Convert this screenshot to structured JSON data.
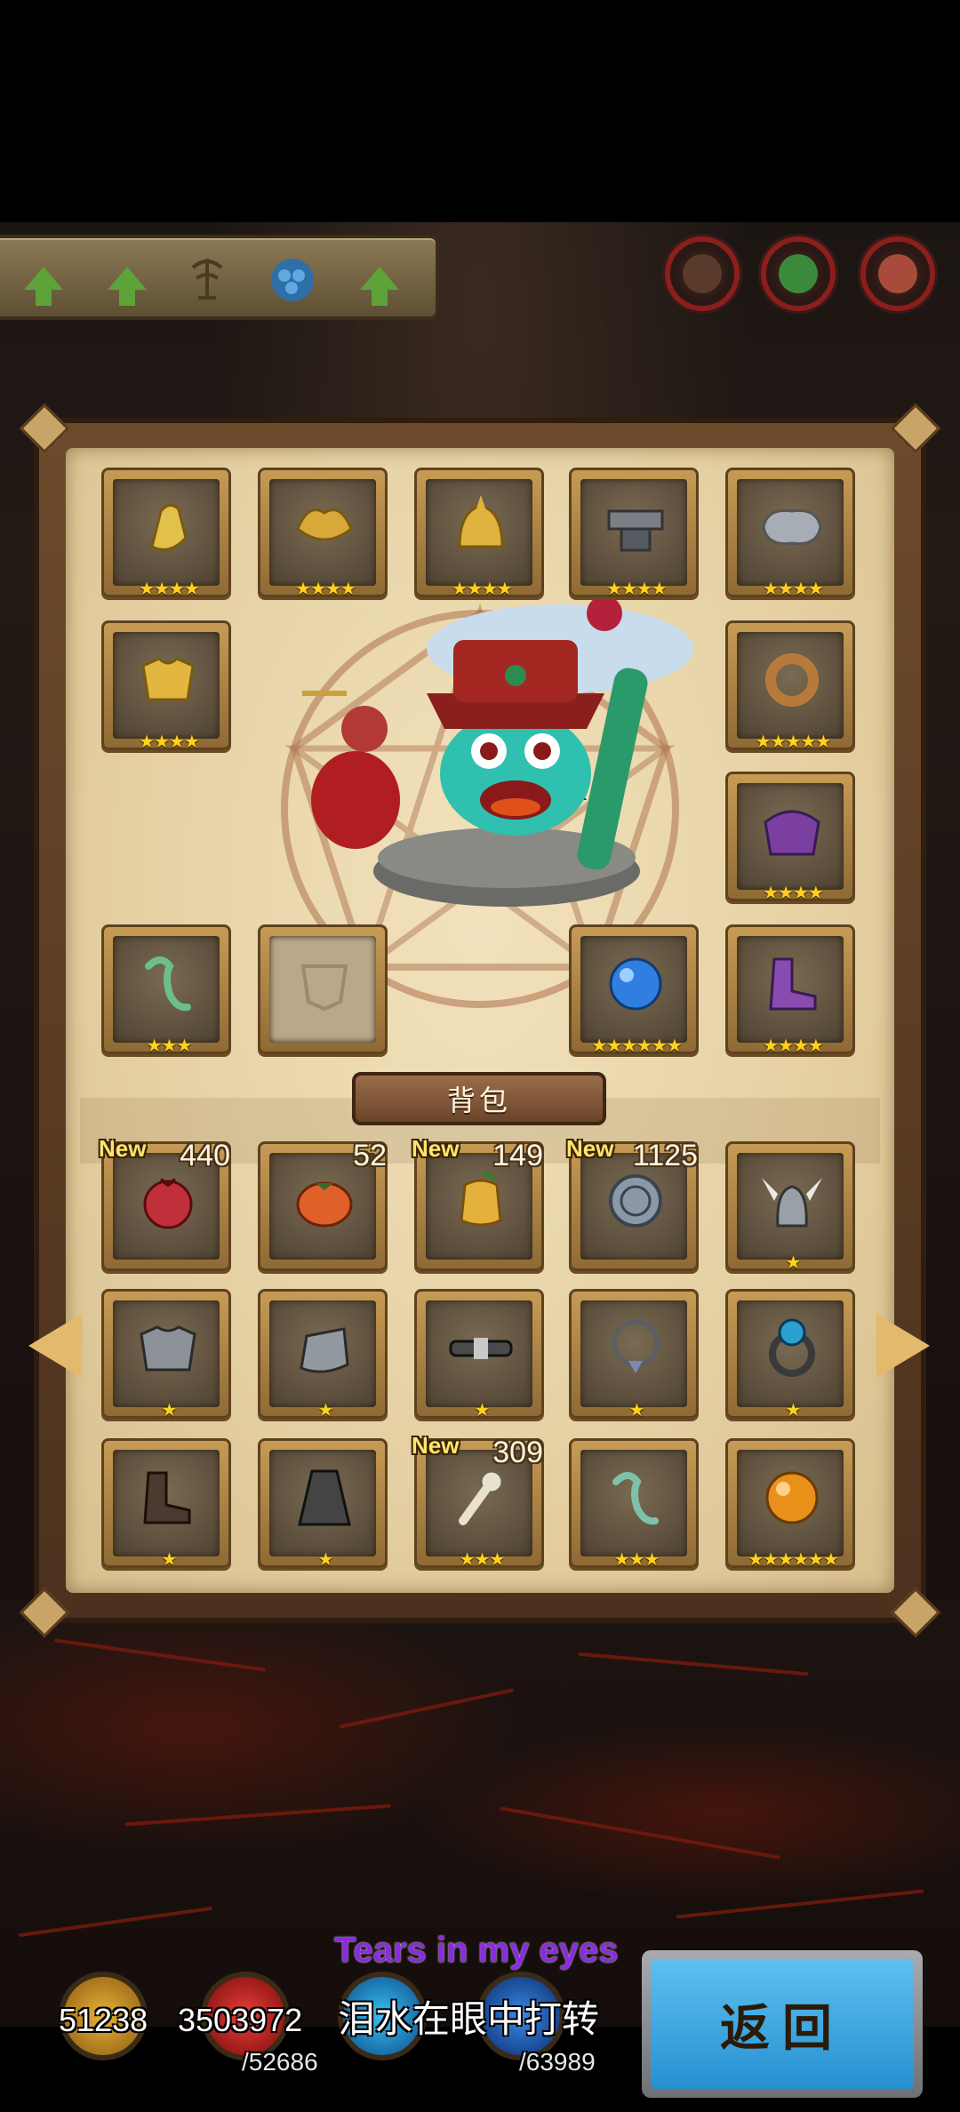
{
  "toolbar": {
    "buttons": [
      {
        "icon": "upgrade-arrow-icon"
      },
      {
        "icon": "upgrade-arrow-icon"
      },
      {
        "icon": "altar-icon"
      },
      {
        "icon": "blue-scale-icon"
      },
      {
        "icon": "upgrade-arrow-icon"
      }
    ]
  },
  "portraits": [
    {
      "icon": "hero-portrait-icon",
      "color": "#5a3a2a"
    },
    {
      "icon": "green-hero-portrait-icon",
      "color": "#3b8a3b"
    },
    {
      "icon": "red-hero-portrait-icon",
      "color": "#a84b3a"
    }
  ],
  "equipment": {
    "slots": [
      {
        "name": "gauntlet",
        "stars": "★★★★",
        "color": "#e2c14a"
      },
      {
        "name": "golden-shoulder",
        "stars": "★★★★",
        "color": "#d9a83a"
      },
      {
        "name": "golden-helmet",
        "stars": "★★★★",
        "color": "#e0b23e"
      },
      {
        "name": "anvil",
        "stars": "★★★★",
        "color": "#7a7f85"
      },
      {
        "name": "silver-lock",
        "stars": "★★★★",
        "color": "#a7adb4"
      },
      {
        "name": "golden-armor",
        "stars": "★★★★",
        "color": "#e3b640"
      },
      {
        "name": "bronze-ring",
        "stars": "★★★★★",
        "color": "#b87a3a"
      },
      {
        "name": "purple-armor",
        "stars": "★★★★",
        "color": "#7a3fa0"
      },
      {
        "name": "jade-ruyi",
        "stars": "★★★",
        "color": "#6dbf8a"
      },
      {
        "name": "empty-slot",
        "stars": "",
        "color": "#8c8070"
      },
      {
        "name": "blue-orb",
        "stars": "★★★★★★",
        "color": "#2f7ee0"
      },
      {
        "name": "purple-boots",
        "stars": "★★★★",
        "color": "#8a4bb0"
      }
    ]
  },
  "backpack": {
    "title": "背包",
    "items": [
      {
        "name": "pomegranate",
        "new": "New",
        "count": "440",
        "stars": "",
        "color": "#c0303a"
      },
      {
        "name": "persimmon",
        "new": "",
        "count": "52",
        "stars": "",
        "color": "#e0602a"
      },
      {
        "name": "buddha-hand",
        "new": "New",
        "count": "149",
        "stars": "",
        "color": "#e4b23c"
      },
      {
        "name": "silver-coin",
        "new": "New",
        "count": "1125",
        "stars": "",
        "color": "#8a98a8"
      },
      {
        "name": "winged-helmet",
        "new": "",
        "count": "",
        "stars": "★",
        "color": "#9aa0a8"
      },
      {
        "name": "steel-armor",
        "new": "",
        "count": "",
        "stars": "★",
        "color": "#8c9198"
      },
      {
        "name": "steel-gauntlet",
        "new": "",
        "count": "",
        "stars": "★",
        "color": "#9399a0"
      },
      {
        "name": "belt",
        "new": "",
        "count": "",
        "stars": "★",
        "color": "#4a4a4a"
      },
      {
        "name": "necklace",
        "new": "",
        "count": "",
        "stars": "★",
        "color": "#5a5f66"
      },
      {
        "name": "blue-gem-ring",
        "new": "",
        "count": "",
        "stars": "★",
        "color": "#2aa0d0"
      },
      {
        "name": "leather-boots",
        "new": "",
        "count": "",
        "stars": "★",
        "color": "#4a3a30"
      },
      {
        "name": "dark-cloak",
        "new": "",
        "count": "",
        "stars": "★",
        "color": "#444444"
      },
      {
        "name": "bone-key",
        "new": "New",
        "count": "309",
        "stars": "★★★",
        "color": "#e8e2cc"
      },
      {
        "name": "jade-ruyi-small",
        "new": "",
        "count": "",
        "stars": "★★★",
        "color": "#7fc0a8"
      },
      {
        "name": "orange-orb",
        "new": "",
        "count": "",
        "stars": "★★★★★★",
        "color": "#e8901a"
      }
    ]
  },
  "resources": {
    "gold": "51238",
    "hp": "3503972",
    "hp_max": "/52686",
    "exp_max": "/63989"
  },
  "lyrics": {
    "english": "Tears in my eyes",
    "chinese": "泪水在眼中打转"
  },
  "return_button": {
    "label": "返回"
  }
}
